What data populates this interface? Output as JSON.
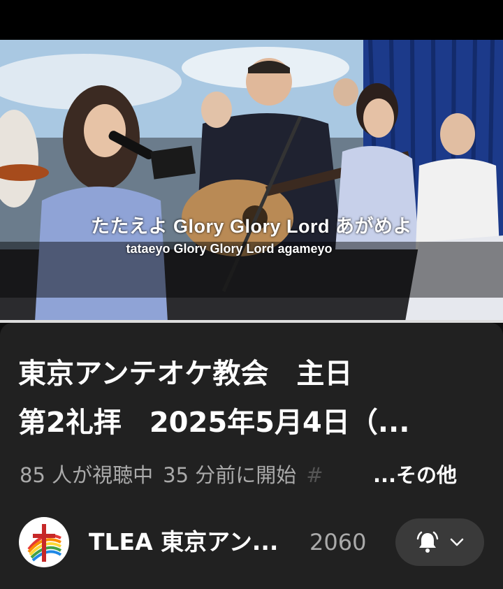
{
  "video": {
    "subtitle_line1": "たたえよ  Glory Glory Lord  あがめよ",
    "subtitle_line2": "tataeyo  Glory Glory Lord  agameyo"
  },
  "details": {
    "title_line1": "東京アンテオケ教会　主日",
    "title_line2": "第2礼拝　2025年5月4日（...",
    "viewers": "85 人が視聴中",
    "started": "35 分前に開始",
    "hashtag_fragment": "#",
    "more_label": "...その他"
  },
  "channel": {
    "name": "TLEA 東京アン...",
    "subscribers": "2060",
    "avatar_icon": "church-cross-logo-icon"
  },
  "subscribe_button": {
    "bell_icon": "bell-ringing-icon",
    "chevron_icon": "chevron-down-icon"
  },
  "colors": {
    "background": "#0f0f0f",
    "sheet": "#212121",
    "secondary_text": "#aaaaaa",
    "button": "#3a3a3a"
  }
}
